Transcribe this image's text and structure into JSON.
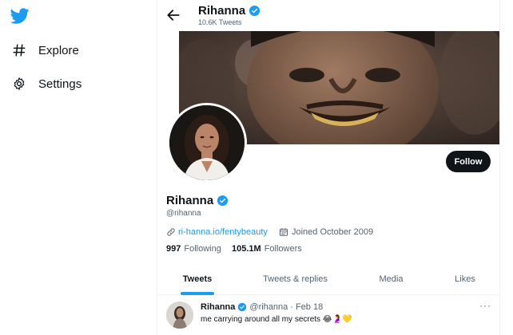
{
  "sidebar": {
    "items": [
      {
        "label": "Explore",
        "icon": "hashtag-icon"
      },
      {
        "label": "Settings",
        "icon": "gear-icon"
      }
    ]
  },
  "header": {
    "name": "Rihanna",
    "tweet_count": "10.6K Tweets"
  },
  "profile": {
    "name": "Rihanna",
    "handle": "@rihanna",
    "website": "ri-hanna.io/fentybeauty",
    "joined": "Joined October 2009",
    "following_count": "997",
    "following_label": "Following",
    "followers_count": "105.1M",
    "followers_label": "Followers",
    "follow_label": "Follow"
  },
  "tabs": [
    {
      "label": "Tweets",
      "active": true
    },
    {
      "label": "Tweets & replies",
      "active": false
    },
    {
      "label": "Media",
      "active": false
    },
    {
      "label": "Likes",
      "active": false
    }
  ],
  "tweet": {
    "name": "Rihanna",
    "handle": "@rihanna",
    "separator": "·",
    "date": "Feb 18",
    "text": "me carrying around all my secrets 😂🤰💛",
    "more": "···"
  },
  "colors": {
    "accent": "#1d9bf0",
    "text": "#0f1419",
    "muted": "#536471",
    "button": "#0f1419"
  }
}
